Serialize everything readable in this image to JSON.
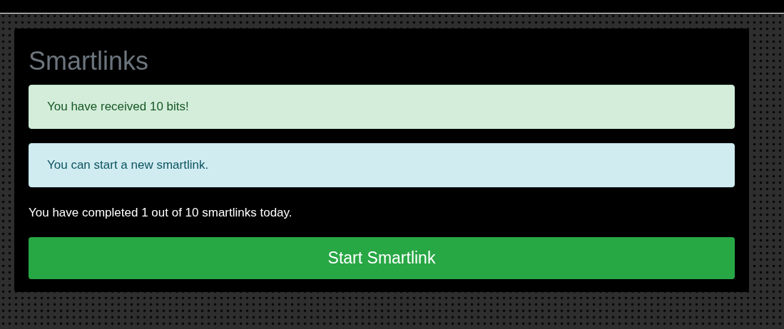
{
  "title": "Smartlinks",
  "alerts": [
    {
      "kind": "success",
      "text": "You have received 10 bits!"
    },
    {
      "kind": "info",
      "text": "You can start a new smartlink."
    }
  ],
  "progress_text": "You have completed 1 out of 10 smartlinks today.",
  "button": "Start Smartlink"
}
